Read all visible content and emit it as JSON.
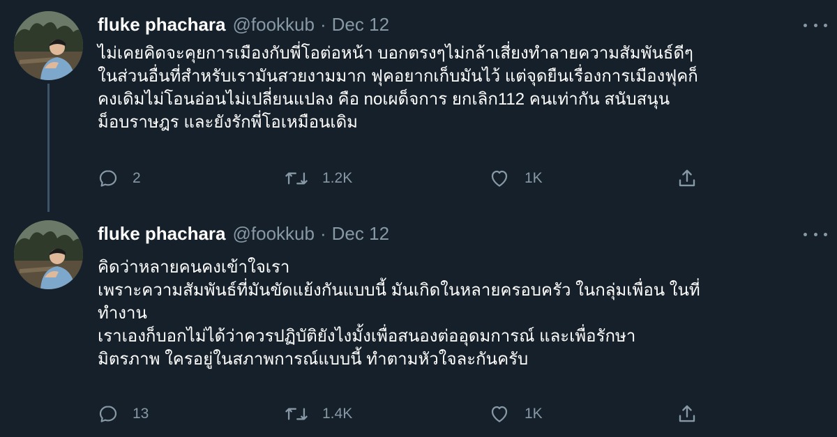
{
  "tweets": [
    {
      "author_name": "fluke phachara",
      "handle": "@fookkub",
      "separator": "·",
      "date": "Dec 12",
      "avatar_icon": "avatar-photo",
      "lines": [
        "ไม่เคยคิดจะคุยการเมืองกับพี่โอต่อหน้า บอกตรงๆไม่กล้าเสี่ยงทำลายความสัมพันธ์ดีๆ",
        "ในส่วนอื่นที่สำหรับเรามันสวยงามมาก ฟุคอยากเก็บมันไว้ แต่จุดยืนเรื่องการเมืองฟุคก็",
        "คงเดิมไม่โอนอ่อนไม่เปลี่ยนแปลง คือ noเผด็จการ ยกเลิก112 คนเท่ากัน สนับสนุน",
        "ม็อบราษฎร และยังรักพี่โอเหมือนเดิม"
      ],
      "replies": "2",
      "retweets": "1.2K",
      "likes": "1K"
    },
    {
      "author_name": "fluke phachara",
      "handle": "@fookkub",
      "separator": "·",
      "date": "Dec 12",
      "avatar_icon": "avatar-photo",
      "lines": [
        "คิดว่าหลายคนคงเข้าใจเรา",
        "เพราะความสัมพันธ์ที่มันขัดแย้งกันแบบนี้ มันเกิดในหลายครอบครัว ในกลุ่มเพื่อน ในที่",
        "ทำงาน",
        "เราเองก็บอกไม่ได้ว่าควรปฏิบัติยังไงมั้งเพื่อสนองต่ออุดมการณ์ และเพื่อรักษา",
        "มิตรภาพ ใครอยู่ในสภาพการณ์แบบนี้ ทำตามหัวใจละกันครับ"
      ],
      "replies": "13",
      "retweets": "1.4K",
      "likes": "1K"
    }
  ],
  "icons": {
    "more": "more-icon",
    "reply": "reply-icon",
    "retweet": "retweet-icon",
    "like": "like-icon",
    "share": "share-icon"
  },
  "colors": {
    "background": "#15202b",
    "text": "#ffffff",
    "secondary": "#8899a6",
    "thread_line": "#3d5466"
  }
}
